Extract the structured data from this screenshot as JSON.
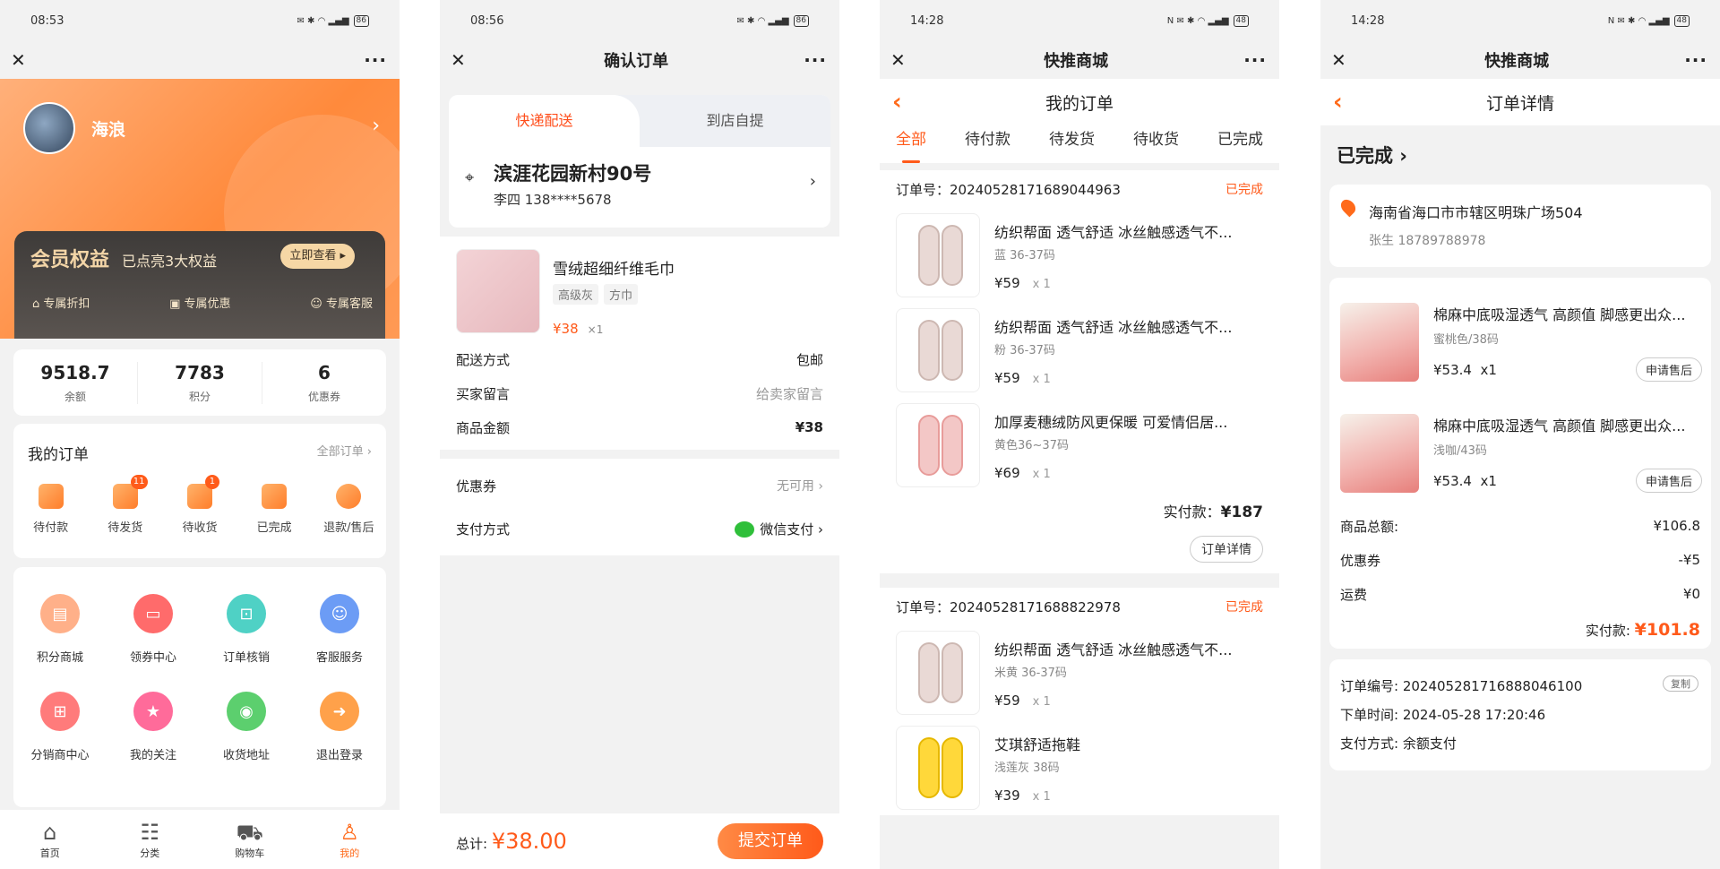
{
  "p1": {
    "time": "08:53",
    "batt": "86",
    "user": {
      "name": "海浪"
    },
    "member": {
      "title": "会员权益",
      "sub": "已点亮3大权益",
      "btn": "立即查看",
      "items": [
        "专属折扣",
        "专属优惠",
        "专属客服"
      ]
    },
    "stats": [
      {
        "v": "9518.7",
        "l": "余额"
      },
      {
        "v": "7783",
        "l": "积分"
      },
      {
        "v": "6",
        "l": "优惠券"
      }
    ],
    "orders": {
      "title": "我的订单",
      "all": "全部订单",
      "items": [
        {
          "label": "待付款",
          "badge": ""
        },
        {
          "label": "待发货",
          "badge": "11"
        },
        {
          "label": "待收货",
          "badge": "1"
        },
        {
          "label": "已完成",
          "badge": ""
        },
        {
          "label": "退款/售后",
          "badge": ""
        }
      ]
    },
    "services": [
      {
        "label": "积分商城",
        "color": "#ffb089"
      },
      {
        "label": "领券中心",
        "color": "#ff6b6b"
      },
      {
        "label": "订单核销",
        "color": "#4fd1c5"
      },
      {
        "label": "客服服务",
        "color": "#6c9cf5"
      },
      {
        "label": "分销商中心",
        "color": "#ff7b7b"
      },
      {
        "label": "我的关注",
        "color": "#ff6b9a"
      },
      {
        "label": "收货地址",
        "color": "#5ccf6e"
      },
      {
        "label": "退出登录",
        "color": "#ffa14a"
      }
    ],
    "tabs": [
      {
        "label": "首页"
      },
      {
        "label": "分类"
      },
      {
        "label": "购物车"
      },
      {
        "label": "我的"
      }
    ]
  },
  "p2": {
    "time": "08:56",
    "batt": "86",
    "title": "确认订单",
    "tabs": [
      "快递配送",
      "到店自提"
    ],
    "addr": {
      "name": "滨涯花园新村90号",
      "contact": "李四   138****5678"
    },
    "item": {
      "name": "雪绒超细纤维毛巾",
      "tags": [
        "高级灰",
        "方巾"
      ],
      "price": "¥38",
      "qty": "×1"
    },
    "rows": [
      {
        "k": "配送方式",
        "v": "包邮"
      },
      {
        "k": "买家留言",
        "v": "给卖家留言"
      },
      {
        "k": "商品金额",
        "v": "¥38"
      }
    ],
    "coupon": {
      "k": "优惠券",
      "v": "无可用 ›"
    },
    "pay": {
      "k": "支付方式",
      "v": "微信支付 ›"
    },
    "total_label": "总计:",
    "total": "¥38.00",
    "submit": "提交订单"
  },
  "p3": {
    "time": "14:28",
    "batt": "48",
    "title": "快推商城",
    "subtitle": "我的订单",
    "tabs": [
      "全部",
      "待付款",
      "待发货",
      "待收货",
      "已完成"
    ],
    "order1": {
      "no": "订单号：20240528171689044963",
      "status": "已完成",
      "items": [
        {
          "name": "纺织帮面 透气舒适 冰丝触感透气不...",
          "spec": "蓝 36-37码",
          "price": "¥59",
          "qty": "x 1"
        },
        {
          "name": "纺织帮面 透气舒适 冰丝触感透气不...",
          "spec": "粉 36-37码",
          "price": "¥59",
          "qty": "x 1"
        },
        {
          "name": "加厚麦穗绒防风更保暖 可爱情侣居...",
          "spec": "黄色36~37码",
          "price": "¥69",
          "qty": "x 1"
        }
      ],
      "paid_label": "实付款：",
      "paid": "¥187",
      "btn": "订单详情"
    },
    "order2": {
      "no": "订单号：20240528171688822978",
      "status": "已完成",
      "items": [
        {
          "name": "纺织帮面 透气舒适 冰丝触感透气不...",
          "spec": "米黄 36-37码",
          "price": "¥59",
          "qty": "x 1"
        },
        {
          "name": "艾琪舒适拖鞋",
          "spec": "浅莲灰 38码",
          "price": "¥39",
          "qty": "x 1"
        }
      ]
    }
  },
  "p4": {
    "time": "14:28",
    "batt": "48",
    "title": "快推商城",
    "subtitle": "订单详情",
    "status": "已完成 ›",
    "addr": {
      "line": "海南省海口市市辖区明珠广场504",
      "contact": "张生   18789788978"
    },
    "items": [
      {
        "name": "棉麻中底吸湿透气 高颜值 脚感更出众...",
        "spec": "蜜桃色/38码",
        "price": "¥53.4",
        "qty": "x1",
        "btn": "申请售后"
      },
      {
        "name": "棉麻中底吸湿透气 高颜值 脚感更出众...",
        "spec": "浅咖/43码",
        "price": "¥53.4",
        "qty": "x1",
        "btn": "申请售后"
      }
    ],
    "sum": [
      {
        "k": "商品总额:",
        "v": "¥106.8"
      },
      {
        "k": "优惠券",
        "v": "-¥5"
      },
      {
        "k": "运费",
        "v": "¥0"
      }
    ],
    "real_label": "实付款:",
    "real": "¥101.8",
    "info": {
      "no": "订单编号:  20240528171688804610​0",
      "time": "下单时间:  2024-05-28 17:20:46",
      "pay": "支付方式:  余额支付",
      "copy": "复制"
    }
  }
}
